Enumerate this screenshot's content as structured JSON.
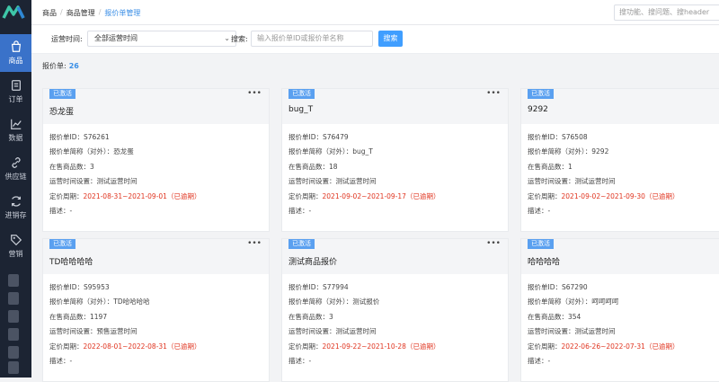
{
  "sidebar": {
    "items": [
      {
        "label": "商品",
        "icon": "shopping-bag-icon",
        "active": true
      },
      {
        "label": "订单",
        "icon": "order-icon",
        "active": false
      },
      {
        "label": "数据",
        "icon": "chart-icon",
        "active": false
      },
      {
        "label": "供应链",
        "icon": "supply-chain-icon",
        "active": false
      },
      {
        "label": "进销存",
        "icon": "inventory-icon",
        "active": false
      },
      {
        "label": "营销",
        "icon": "tag-icon",
        "active": false
      }
    ]
  },
  "topbar": {
    "breadcrumb": [
      "商品",
      "商品管理",
      "报价单管理"
    ],
    "search_placeholder": "搜功能、搜问题、搜header"
  },
  "filters": {
    "op_time_label": "运营时间:",
    "op_time_value": "全部运营时间",
    "search_label": "搜索:",
    "search_placeholder": "输入报价单ID或报价单名称",
    "search_button": "搜索"
  },
  "summary": {
    "label": "报价单:",
    "count": "26"
  },
  "accent_color": "#409eff",
  "expired_color": "#e0341f",
  "cards": [
    {
      "badge": "已激活",
      "title": "恐龙蛋",
      "id_line": "报价单ID：S76261",
      "alias_line": "报价单简称（对外）：恐龙蛋",
      "count_line": "在售商品数：3",
      "time_line": "运营时间设置：测试运营时间",
      "period_label": "定价周期：",
      "period": "2021-08-31~2021-09-01（已逾期）",
      "desc_line": "描述：-"
    },
    {
      "badge": "已激活",
      "title": "bug_T",
      "id_line": "报价单ID：S76479",
      "alias_line": "报价单简称（对外）：bug_T",
      "count_line": "在售商品数：18",
      "time_line": "运营时间设置：测试运营时间",
      "period_label": "定价周期：",
      "period": "2021-09-02~2021-09-17（已逾期）",
      "desc_line": "描述：-"
    },
    {
      "badge": "已激活",
      "title": "9292",
      "id_line": "报价单ID：S76508",
      "alias_line": "报价单简称（对外）：9292",
      "count_line": "在售商品数：1",
      "time_line": "运营时间设置：测试运营时间",
      "period_label": "定价周期：",
      "period": "2021-09-02~2021-09-30（已逾期）",
      "desc_line": "描述：-"
    },
    {
      "badge": "已激活",
      "title": "TD哈哈哈哈",
      "id_line": "报价单ID：S95953",
      "alias_line": "报价单简称（对外）：TD哈哈哈哈",
      "count_line": "在售商品数：1197",
      "time_line": "运营时间设置：预售运营时间",
      "period_label": "定价周期：",
      "period": "2022-08-01~2022-08-31（已逾期）",
      "desc_line": "描述：-"
    },
    {
      "badge": "已激活",
      "title": "测试商品报价",
      "id_line": "报价单ID：S77994",
      "alias_line": "报价单简称（对外）：测试报价",
      "count_line": "在售商品数：3",
      "time_line": "运营时间设置：测试运营时间",
      "period_label": "定价周期：",
      "period": "2021-09-22~2021-10-28（已逾期）",
      "desc_line": "描述：-"
    },
    {
      "badge": "已激活",
      "title": "哈哈哈哈",
      "id_line": "报价单ID：S67290",
      "alias_line": "报价单简称（对外）：呵呵呵呵",
      "count_line": "在售商品数：354",
      "time_line": "运营时间设置：测试运营时间",
      "period_label": "定价周期：",
      "period": "2022-06-26~2022-07-31（已逾期）",
      "desc_line": "描述：-"
    }
  ]
}
